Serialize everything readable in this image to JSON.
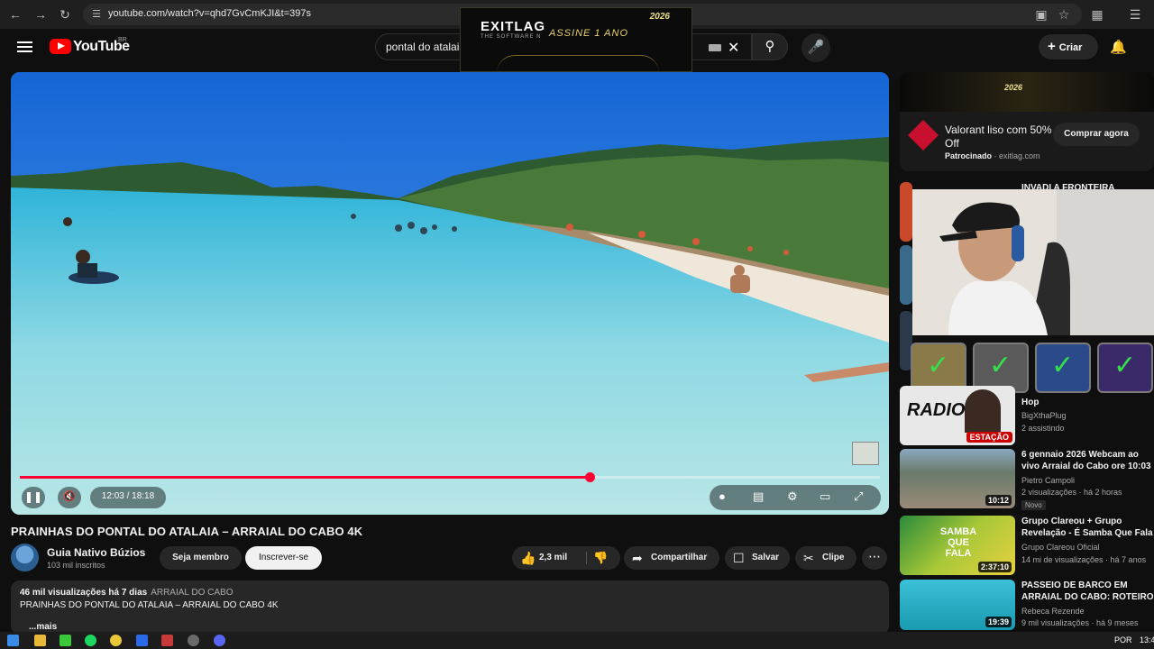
{
  "browser": {
    "url": "youtube.com/watch?v=qhd7GvCmKJI&t=397s"
  },
  "overlay_ad": {
    "brand": "EXITLAG",
    "tagline": "THE SOFTWARE N",
    "cta": "ASSINE 1 ANO",
    "year": "2026"
  },
  "header": {
    "logo_text": "YouTube",
    "country": "BR",
    "search_value": "pontal do atalaia",
    "create_label": "Criar"
  },
  "player": {
    "progress_fraction": 0.662,
    "time": "12:03 / 18:18"
  },
  "video": {
    "title": "PRAINHAS DO PONTAL DO ATALAIA – ARRAIAL DO CABO 4K",
    "channel": "Guia Nativo Búzios",
    "subscribers": "103 mil inscritos",
    "member_label": "Seja membro",
    "subscribe_label": "Inscrever-se",
    "likes": "2,3 mil",
    "share_label": "Compartilhar",
    "save_label": "Salvar",
    "clip_label": "Clipe",
    "views_date": "46 mil visualizações  há 7 dias",
    "tag": "ARRAIAL DO CABO",
    "desc_line": "PRAINHAS DO PONTAL DO ATALAIA – ARRAIAL DO CABO 4K",
    "more_label": "...mais"
  },
  "sidebar_ad": {
    "banner_text": "2026",
    "title": "Valorant liso com 50% Off",
    "sponsored": "Patrocinado",
    "domain": "exitlag.com",
    "buy_label": "Comprar agora"
  },
  "recommendations": [
    {
      "title": "INVADI A FRONTEIRA",
      "channel": "",
      "meta": "",
      "duration": ""
    },
    {
      "title": "Hop",
      "channel": "BigXthaPlug",
      "meta": "2 assistindo",
      "duration": "",
      "badge": "ESTAÇÃO",
      "thumb_text": "RADIO"
    },
    {
      "title": "6 gennaio 2026  Webcam ao",
      "title2": "vivo  Arraial do Cabo  ore 10:03",
      "channel": "Pietro Campoli",
      "meta": "2 visualizações · há 2 horas",
      "new_label": "Novo",
      "duration": "10:12"
    },
    {
      "title": "Grupo Clareou + Grupo",
      "title2": "Revelação - É Samba Que Fala",
      "channel": "Grupo Clareou Oficial",
      "meta": "14 mi de visualizações · há 7 anos",
      "duration": "2:37:10",
      "thumb_text": "SAMBA QUE FALA"
    },
    {
      "title": "PASSEIO DE BARCO EM",
      "title2": "ARRAIAL DO CABO: ROTEIRO ...",
      "channel": "Rebeca Rezende",
      "meta": "9 mil visualizações · há 9 meses",
      "duration": "19:39"
    }
  ],
  "taskbar": {
    "lang": "POR",
    "clock": "13:4"
  }
}
